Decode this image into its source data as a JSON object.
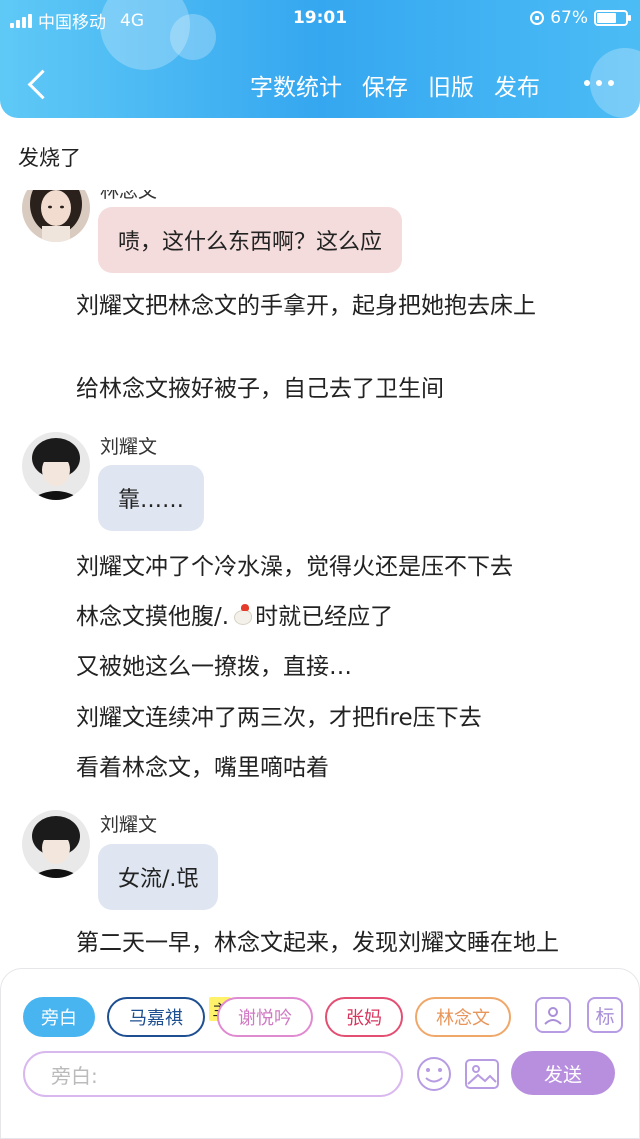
{
  "status_bar": {
    "carrier": "中国移动",
    "network": "4G",
    "time": "19:01",
    "battery": "67%",
    "battery_level": 0.67
  },
  "nav": {
    "actions": [
      "字数统计",
      "保存",
      "旧版",
      "发布"
    ]
  },
  "story": {
    "title": "发烧了",
    "items": [
      {
        "type": "dialogue",
        "speaker": "林念文",
        "text": "啧，这什么东西啊？这么应",
        "bubble_color": "#f4dcdc"
      },
      {
        "type": "narration",
        "text": "刘耀文把林念文的手拿开，起身把她抱去床上"
      },
      {
        "type": "narration",
        "text": "给林念文掖好被子，自己去了卫生间"
      },
      {
        "type": "dialogue",
        "speaker": "刘耀文",
        "text": "靠……",
        "bubble_color": "#dfe6f1"
      },
      {
        "type": "narration",
        "text": "刘耀文冲了个冷水澡，觉得火还是压不下去"
      },
      {
        "type": "narration",
        "text_before": "林念文摸他腹/.",
        "icon": "rooster-emoji",
        "text_after": "时就已经应了"
      },
      {
        "type": "narration",
        "text": "又被她这么一撩拨，直接…"
      },
      {
        "type": "narration",
        "text": "刘耀文连续冲了两三次，才把fire压下去"
      },
      {
        "type": "narration",
        "text": "看着林念文，嘴里嘀咕着"
      },
      {
        "type": "dialogue",
        "speaker": "刘耀文",
        "text": "女流/.氓",
        "bubble_color": "#dfe6f1"
      },
      {
        "type": "narration",
        "text": "第二天一早，林念文起来，发现刘耀文睡在地上"
      }
    ]
  },
  "panel": {
    "chips": [
      {
        "label": "旁白",
        "style": "active"
      },
      {
        "label": "马嘉祺",
        "style": "blue"
      },
      {
        "label": "谢悦吟",
        "style": "pink"
      },
      {
        "label": "张妈",
        "style": "red"
      },
      {
        "label": "林念文",
        "style": "orange"
      }
    ],
    "host_tag": "主",
    "tag_button": "标",
    "input_placeholder": "旁白:",
    "send_label": "发送"
  },
  "colors": {
    "header_gradient": [
      "#5fc9f6",
      "#35a7f0"
    ],
    "accent_purple": "#b88fdf",
    "active_chip": "#48b5f1"
  }
}
